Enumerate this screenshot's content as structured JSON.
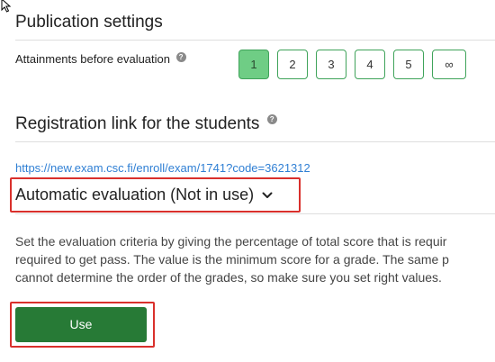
{
  "publication": {
    "title": "Publication settings",
    "attainments_label": "Attainments before evaluation",
    "help_icon": "question-icon",
    "options": [
      "1",
      "2",
      "3",
      "4",
      "5",
      "∞"
    ],
    "selected_option": "1"
  },
  "registration": {
    "title": "Registration link for the students",
    "help_icon": "question-icon",
    "link": "https://new.exam.csc.fi/enroll/exam/1741?code=3621312"
  },
  "evaluation": {
    "title": "Automatic evaluation (Not in use)",
    "chevron_icon": "chevron-down-icon",
    "description_lines": [
      "Set the evaluation criteria by giving the percentage of total score that is requir",
      "required to get pass. The value is the minimum score for a grade. The same p",
      "cannot determine the order of the grades, so make sure you set right values."
    ],
    "use_button": "Use"
  },
  "colors": {
    "accent_green": "#277a36",
    "selected_green": "#6fcd85",
    "link_blue": "#2f7fd4",
    "highlight_red": "#d9302c"
  }
}
